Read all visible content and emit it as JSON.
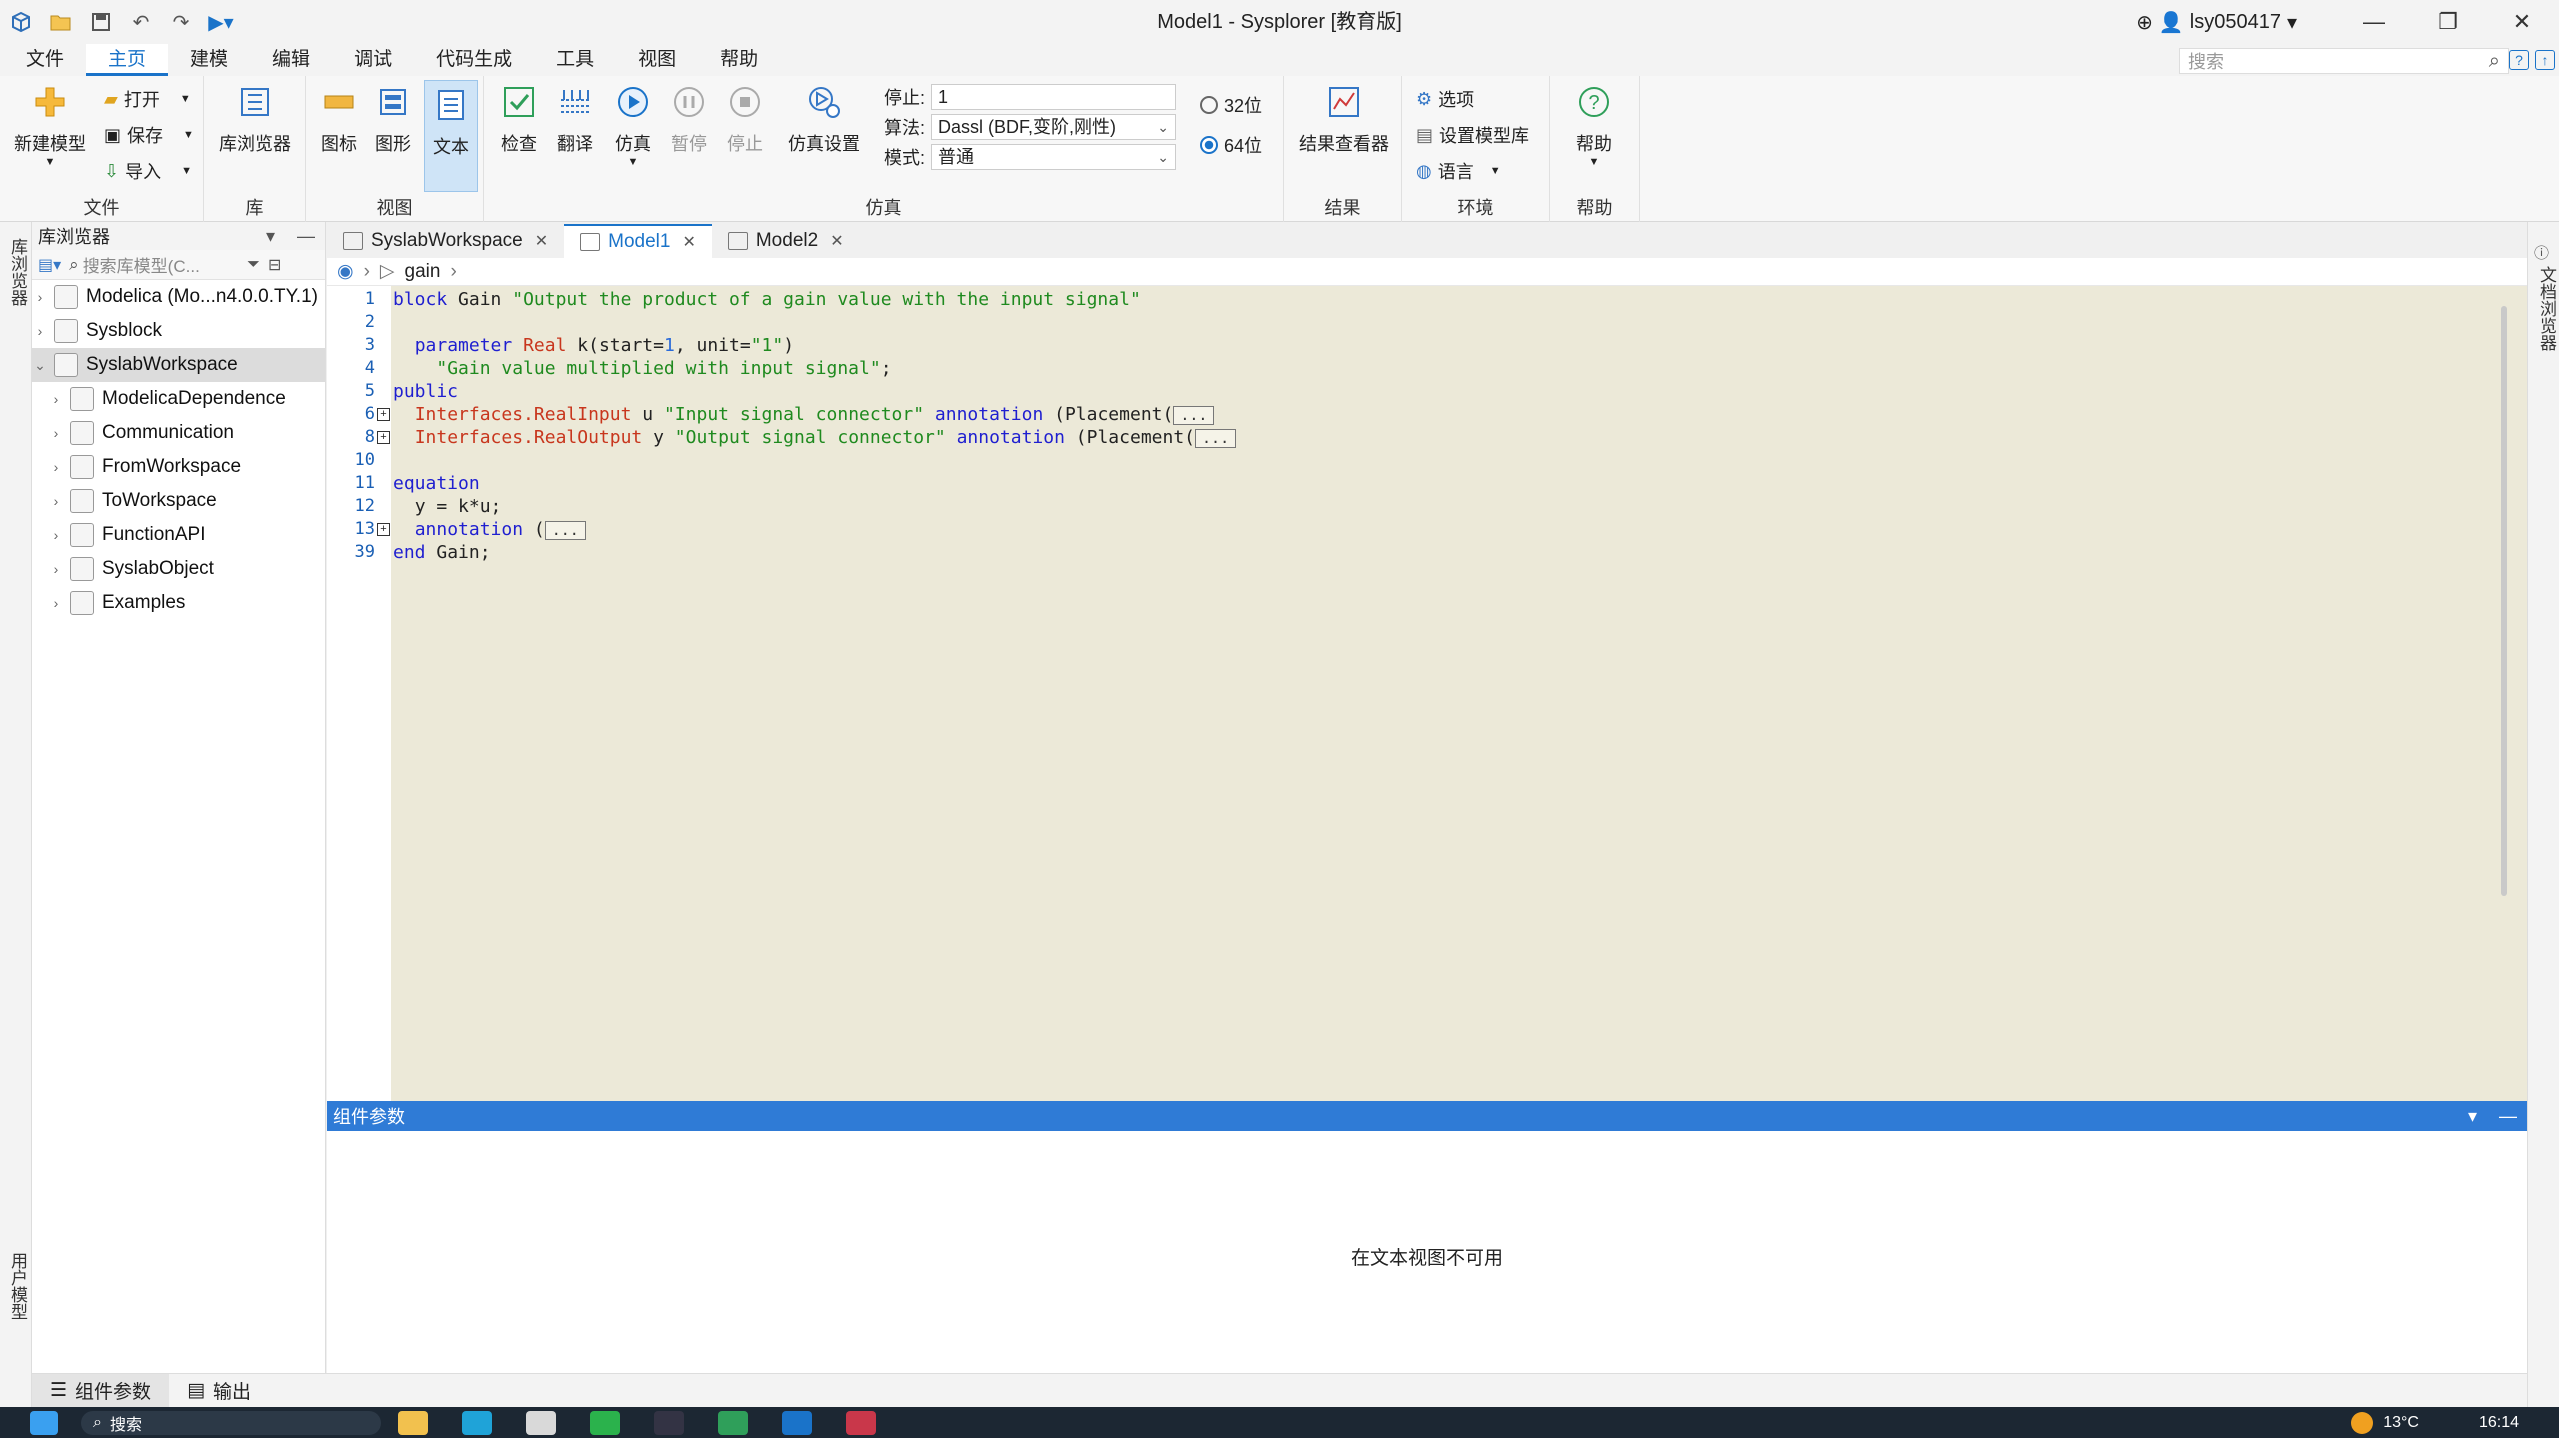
{
  "window": {
    "title": "Model1 - Sysplorer [教育版]",
    "user": "lsy050417"
  },
  "menu": {
    "items": [
      "文件",
      "主页",
      "建模",
      "编辑",
      "调试",
      "代码生成",
      "工具",
      "视图",
      "帮助"
    ],
    "active": "主页",
    "search_placeholder": "搜索"
  },
  "ribbon": {
    "file": {
      "new_model": "新建模型",
      "open": "打开",
      "save": "保存",
      "import": "导入",
      "label": "文件"
    },
    "lib": {
      "browser": "库浏览器",
      "label": "库"
    },
    "view": {
      "icon": "图标",
      "diagram": "图形",
      "text": "文本",
      "label": "视图"
    },
    "sim": {
      "check": "检查",
      "translate": "翻译",
      "simulate": "仿真",
      "pause": "暂停",
      "stop": "停止",
      "settings": "仿真设置",
      "stop_time_label": "停止:",
      "stop_time_value": "1",
      "algo_label": "算法:",
      "algo_value": "Dassl (BDF,变阶,刚性)",
      "mode_label": "模式:",
      "mode_value": "普通",
      "bit32": "32位",
      "bit64": "64位",
      "selected_bits": "64位",
      "label": "仿真"
    },
    "result": {
      "viewer": "结果查看器",
      "label": "结果"
    },
    "env": {
      "options": "选项",
      "model_lib": "设置模型库",
      "language": "语言",
      "label": "环境"
    },
    "help": {
      "help": "帮助",
      "label": "帮助"
    }
  },
  "left_strip": {
    "lib_browser": "库浏览器",
    "user_models": "用户模型"
  },
  "library": {
    "title": "库浏览器",
    "search_placeholder": "搜索库模型(C...",
    "items": [
      {
        "label": "Modelica (Mo...n4.0.0.TY.1)",
        "level": 0,
        "expanded": false,
        "selected": false
      },
      {
        "label": "Sysblock",
        "level": 0,
        "expanded": false,
        "selected": false
      },
      {
        "label": "SyslabWorkspace",
        "level": 0,
        "expanded": true,
        "selected": true
      },
      {
        "label": "ModelicaDependence",
        "level": 1,
        "expanded": false,
        "selected": false
      },
      {
        "label": "Communication",
        "level": 1,
        "expanded": false,
        "selected": false
      },
      {
        "label": "FromWorkspace",
        "level": 1,
        "expanded": false,
        "selected": false
      },
      {
        "label": "ToWorkspace",
        "level": 1,
        "expanded": false,
        "selected": false
      },
      {
        "label": "FunctionAPI",
        "level": 1,
        "expanded": false,
        "selected": false
      },
      {
        "label": "SyslabObject",
        "level": 1,
        "expanded": false,
        "selected": false
      },
      {
        "label": "Examples",
        "level": 1,
        "expanded": false,
        "selected": false
      }
    ]
  },
  "tabs": [
    {
      "label": "SyslabWorkspace",
      "active": false
    },
    {
      "label": "Model1",
      "active": true
    },
    {
      "label": "Model2",
      "active": false
    }
  ],
  "breadcrumb": {
    "item": "gain"
  },
  "code": {
    "line_numbers": [
      "1",
      "2",
      "3",
      "4",
      "5",
      "6",
      "8",
      "10",
      "11",
      "12",
      "13",
      "39"
    ],
    "collapsed": "..."
  },
  "params": {
    "title": "组件参数",
    "message": "在文本视图不可用"
  },
  "right_strip": {
    "doc_browser": "文档浏览器"
  },
  "bottom_tabs": {
    "params": "组件参数",
    "output": "输出"
  },
  "taskbar": {
    "search": "搜索",
    "weather": "13°C",
    "clock": "16:14"
  }
}
